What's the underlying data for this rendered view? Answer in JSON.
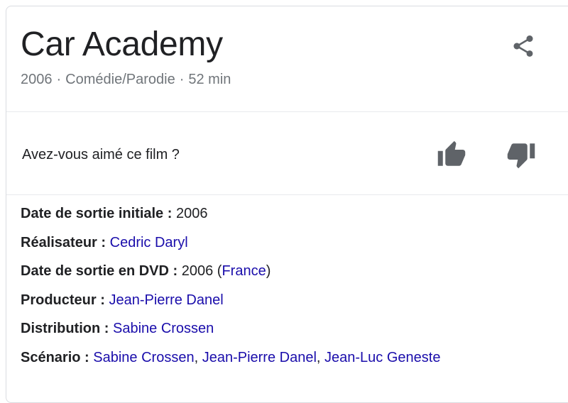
{
  "header": {
    "title": "Car Academy",
    "year": "2006",
    "genre": "Comédie/Parodie",
    "duration": "52 min",
    "separator": "·"
  },
  "rating": {
    "question": "Avez-vous aimé ce film ?"
  },
  "facts": {
    "release_label": "Date de sortie initiale :",
    "release_value": "2006",
    "director_label": "Réalisateur :",
    "director": "Cedric Daryl",
    "dvd_label": "Date de sortie en DVD :",
    "dvd_year": "2006",
    "dvd_open": "(",
    "dvd_country": "France",
    "dvd_close": ")",
    "producer_label": "Producteur :",
    "producer": "Jean-Pierre Danel",
    "distribution_label": "Distribution :",
    "distribution": "Sabine Crossen",
    "screenplay_label": "Scénario :",
    "screenplay_1": "Sabine Crossen",
    "screenplay_2": "Jean-Pierre Danel",
    "screenplay_3": "Jean-Luc Geneste",
    "comma": ","
  },
  "icons": {
    "share": "share-icon",
    "thumb_up": "thumb-up-icon",
    "thumb_down": "thumb-down-icon"
  },
  "colors": {
    "link": "#1a0dab",
    "muted": "#70757a",
    "icon": "#5f6368"
  }
}
